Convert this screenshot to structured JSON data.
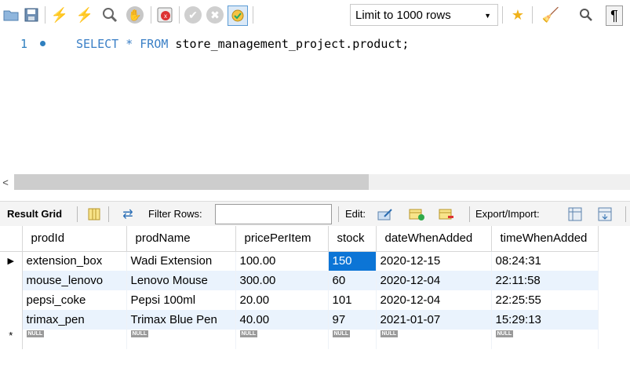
{
  "toolbar": {
    "limit_label": "Limit to 1000 rows",
    "icons": [
      "folder-icon",
      "save-icon",
      "execute-icon",
      "execute-current-icon",
      "explain-icon",
      "stop-icon",
      "toggle-stop-on-error-icon",
      "commit-icon",
      "rollback-icon",
      "autocommit-icon",
      "add-snippet-icon",
      "beautify-icon",
      "find-icon",
      "invisible-chars-icon"
    ]
  },
  "editor": {
    "line_number": "1",
    "sql_kw1": "SELECT",
    "sql_star": " * ",
    "sql_kw2": "FROM",
    "sql_rest": " store_management_project.product;"
  },
  "result_toolbar": {
    "result_grid_label": "Result Grid",
    "filter_label": "Filter Rows:",
    "filter_value": "",
    "edit_label": "Edit:",
    "export_label": "Export/Import:"
  },
  "grid": {
    "columns": [
      "prodId",
      "prodName",
      "pricePerItem",
      "stock",
      "dateWhenAdded",
      "timeWhenAdded"
    ],
    "rows": [
      [
        "extension_box",
        "Wadi Extension",
        "100.00",
        "150",
        "2020-12-15",
        "08:24:31"
      ],
      [
        "mouse_lenovo",
        "Lenovo Mouse",
        "300.00",
        "60",
        "2020-12-04",
        "22:11:58"
      ],
      [
        "pepsi_coke",
        "Pepsi 100ml",
        "20.00",
        "101",
        "2020-12-04",
        "22:25:55"
      ],
      [
        "trimax_pen",
        "Trimax Blue Pen",
        "40.00",
        "97",
        "2021-01-07",
        "15:29:13"
      ]
    ],
    "null_label": "NULL",
    "current_row_marker": "▶",
    "new_row_marker": "*"
  },
  "colors": {
    "accent": "#0c75d6",
    "alt_row": "#eaf3fd",
    "keyword": "#3a7fc6"
  }
}
